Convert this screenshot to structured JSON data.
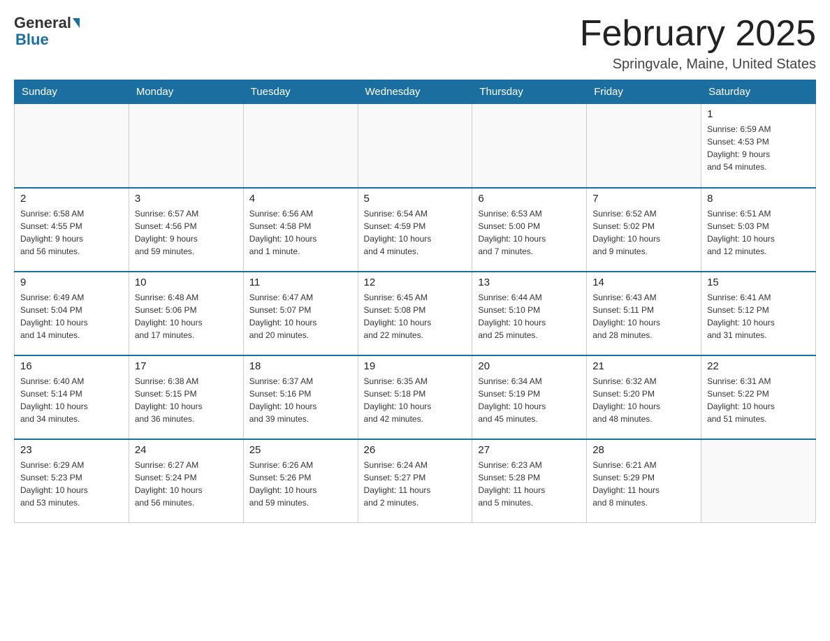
{
  "header": {
    "logo_general": "General",
    "logo_blue": "Blue",
    "month_title": "February 2025",
    "location": "Springvale, Maine, United States"
  },
  "days_of_week": [
    "Sunday",
    "Monday",
    "Tuesday",
    "Wednesday",
    "Thursday",
    "Friday",
    "Saturday"
  ],
  "weeks": [
    [
      {
        "num": "",
        "info": ""
      },
      {
        "num": "",
        "info": ""
      },
      {
        "num": "",
        "info": ""
      },
      {
        "num": "",
        "info": ""
      },
      {
        "num": "",
        "info": ""
      },
      {
        "num": "",
        "info": ""
      },
      {
        "num": "1",
        "info": "Sunrise: 6:59 AM\nSunset: 4:53 PM\nDaylight: 9 hours\nand 54 minutes."
      }
    ],
    [
      {
        "num": "2",
        "info": "Sunrise: 6:58 AM\nSunset: 4:55 PM\nDaylight: 9 hours\nand 56 minutes."
      },
      {
        "num": "3",
        "info": "Sunrise: 6:57 AM\nSunset: 4:56 PM\nDaylight: 9 hours\nand 59 minutes."
      },
      {
        "num": "4",
        "info": "Sunrise: 6:56 AM\nSunset: 4:58 PM\nDaylight: 10 hours\nand 1 minute."
      },
      {
        "num": "5",
        "info": "Sunrise: 6:54 AM\nSunset: 4:59 PM\nDaylight: 10 hours\nand 4 minutes."
      },
      {
        "num": "6",
        "info": "Sunrise: 6:53 AM\nSunset: 5:00 PM\nDaylight: 10 hours\nand 7 minutes."
      },
      {
        "num": "7",
        "info": "Sunrise: 6:52 AM\nSunset: 5:02 PM\nDaylight: 10 hours\nand 9 minutes."
      },
      {
        "num": "8",
        "info": "Sunrise: 6:51 AM\nSunset: 5:03 PM\nDaylight: 10 hours\nand 12 minutes."
      }
    ],
    [
      {
        "num": "9",
        "info": "Sunrise: 6:49 AM\nSunset: 5:04 PM\nDaylight: 10 hours\nand 14 minutes."
      },
      {
        "num": "10",
        "info": "Sunrise: 6:48 AM\nSunset: 5:06 PM\nDaylight: 10 hours\nand 17 minutes."
      },
      {
        "num": "11",
        "info": "Sunrise: 6:47 AM\nSunset: 5:07 PM\nDaylight: 10 hours\nand 20 minutes."
      },
      {
        "num": "12",
        "info": "Sunrise: 6:45 AM\nSunset: 5:08 PM\nDaylight: 10 hours\nand 22 minutes."
      },
      {
        "num": "13",
        "info": "Sunrise: 6:44 AM\nSunset: 5:10 PM\nDaylight: 10 hours\nand 25 minutes."
      },
      {
        "num": "14",
        "info": "Sunrise: 6:43 AM\nSunset: 5:11 PM\nDaylight: 10 hours\nand 28 minutes."
      },
      {
        "num": "15",
        "info": "Sunrise: 6:41 AM\nSunset: 5:12 PM\nDaylight: 10 hours\nand 31 minutes."
      }
    ],
    [
      {
        "num": "16",
        "info": "Sunrise: 6:40 AM\nSunset: 5:14 PM\nDaylight: 10 hours\nand 34 minutes."
      },
      {
        "num": "17",
        "info": "Sunrise: 6:38 AM\nSunset: 5:15 PM\nDaylight: 10 hours\nand 36 minutes."
      },
      {
        "num": "18",
        "info": "Sunrise: 6:37 AM\nSunset: 5:16 PM\nDaylight: 10 hours\nand 39 minutes."
      },
      {
        "num": "19",
        "info": "Sunrise: 6:35 AM\nSunset: 5:18 PM\nDaylight: 10 hours\nand 42 minutes."
      },
      {
        "num": "20",
        "info": "Sunrise: 6:34 AM\nSunset: 5:19 PM\nDaylight: 10 hours\nand 45 minutes."
      },
      {
        "num": "21",
        "info": "Sunrise: 6:32 AM\nSunset: 5:20 PM\nDaylight: 10 hours\nand 48 minutes."
      },
      {
        "num": "22",
        "info": "Sunrise: 6:31 AM\nSunset: 5:22 PM\nDaylight: 10 hours\nand 51 minutes."
      }
    ],
    [
      {
        "num": "23",
        "info": "Sunrise: 6:29 AM\nSunset: 5:23 PM\nDaylight: 10 hours\nand 53 minutes."
      },
      {
        "num": "24",
        "info": "Sunrise: 6:27 AM\nSunset: 5:24 PM\nDaylight: 10 hours\nand 56 minutes."
      },
      {
        "num": "25",
        "info": "Sunrise: 6:26 AM\nSunset: 5:26 PM\nDaylight: 10 hours\nand 59 minutes."
      },
      {
        "num": "26",
        "info": "Sunrise: 6:24 AM\nSunset: 5:27 PM\nDaylight: 11 hours\nand 2 minutes."
      },
      {
        "num": "27",
        "info": "Sunrise: 6:23 AM\nSunset: 5:28 PM\nDaylight: 11 hours\nand 5 minutes."
      },
      {
        "num": "28",
        "info": "Sunrise: 6:21 AM\nSunset: 5:29 PM\nDaylight: 11 hours\nand 8 minutes."
      },
      {
        "num": "",
        "info": ""
      }
    ]
  ]
}
